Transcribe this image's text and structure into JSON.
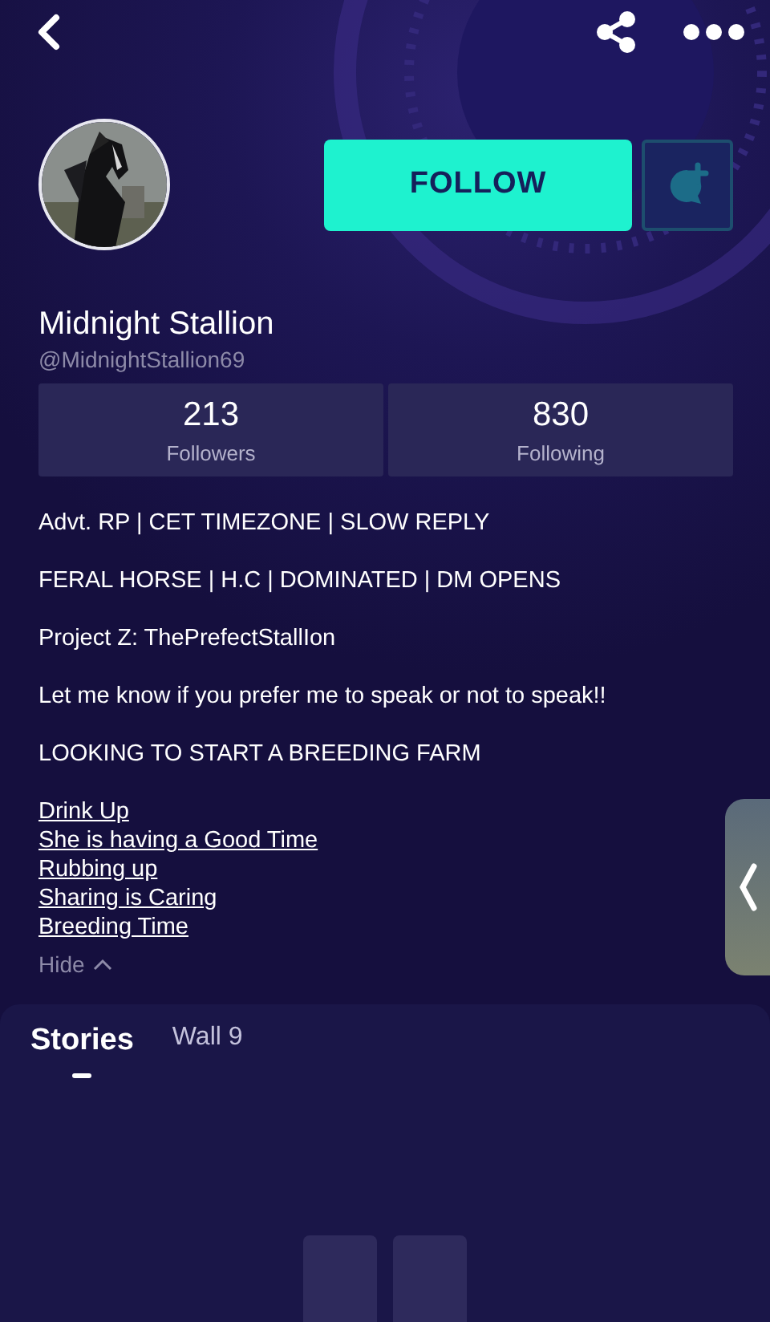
{
  "profile": {
    "name": "Midnight Stallion",
    "handle": "@MidnightStallion69",
    "follow_button": "FOLLOW"
  },
  "stats": [
    {
      "value": "213",
      "label": "Followers"
    },
    {
      "value": "830",
      "label": "Following"
    }
  ],
  "bio": {
    "paragraphs": [
      "Advt. RP | CET TIMEZONE | SLOW REPLY",
      "FERAL HORSE | H.C | DOMINATED | DM OPENS",
      "Project Z: ThePrefectStallIon",
      "Let me know if you prefer me to speak or not to speak!!",
      "LOOKING TO START A BREEDING FARM"
    ],
    "links": [
      "Drink Up",
      "She is having a Good Time",
      "Rubbing up",
      "Sharing is Caring",
      "Breeding Time"
    ],
    "toggle": "Hide"
  },
  "tabs": [
    {
      "label": "Stories",
      "selected": true
    },
    {
      "label": "Wall 9",
      "selected": false
    }
  ]
}
